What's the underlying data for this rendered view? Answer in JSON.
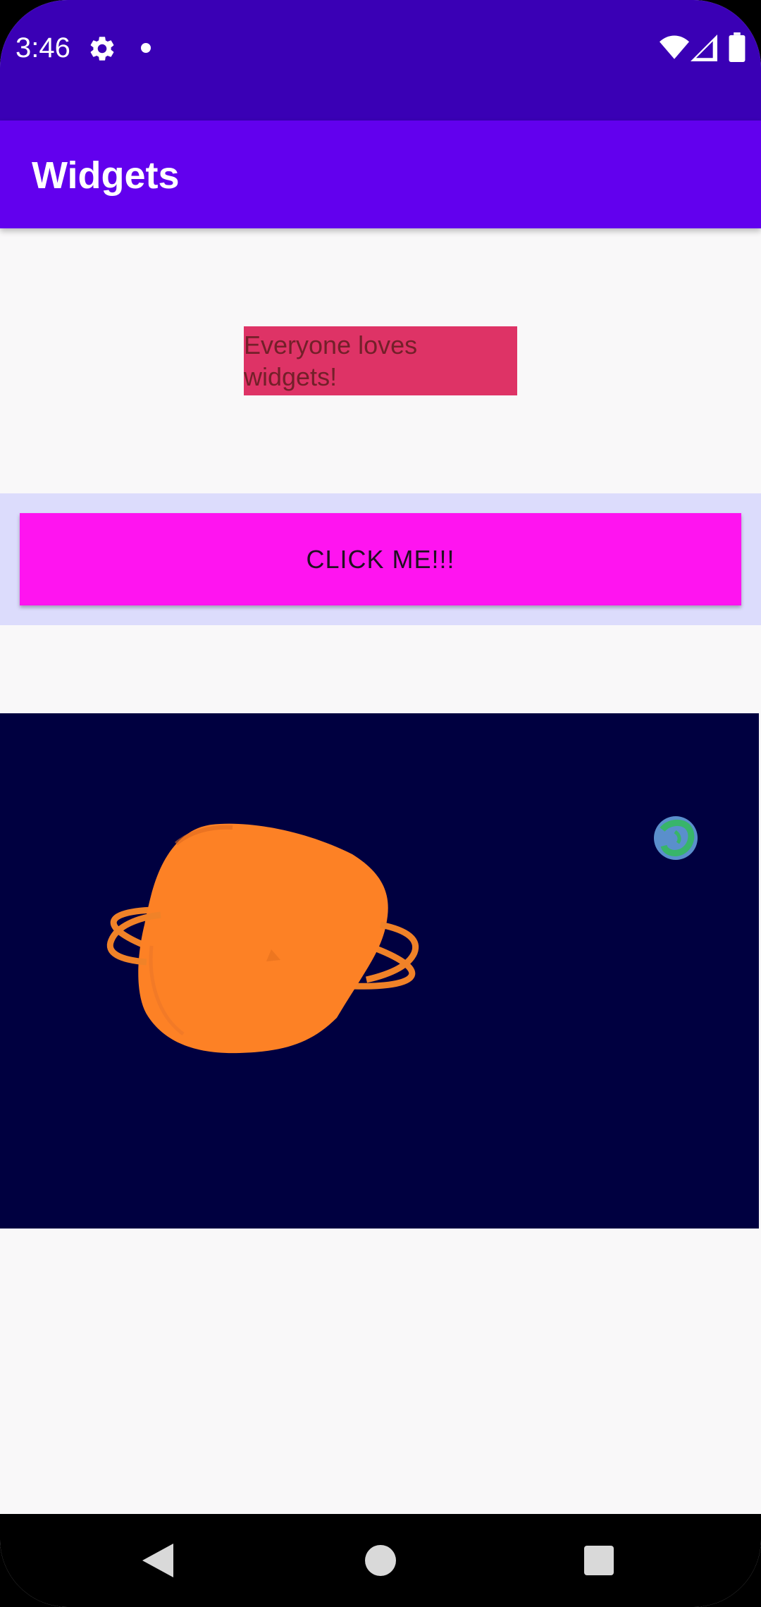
{
  "status_bar": {
    "time": "3:46",
    "icons": [
      "settings-icon",
      "notification-dot-icon",
      "wifi-icon",
      "signal-icon",
      "battery-icon"
    ]
  },
  "app_bar": {
    "title": "Widgets",
    "color": "#6200ee"
  },
  "content": {
    "text_box": {
      "text": "Everyone loves widgets!",
      "background": "#de3366"
    },
    "button": {
      "label": "CLICK ME!!!",
      "background": "#ff14f0"
    },
    "image": {
      "description_icon": "space-planets-image",
      "background": "#000040"
    }
  },
  "nav_bar": {
    "icons": [
      "back-icon",
      "home-icon",
      "recents-icon"
    ]
  },
  "colors": {
    "status_bar": "#3a00b5",
    "page_background": "#f9f8f9",
    "button_strip": "#dcdcfc"
  }
}
